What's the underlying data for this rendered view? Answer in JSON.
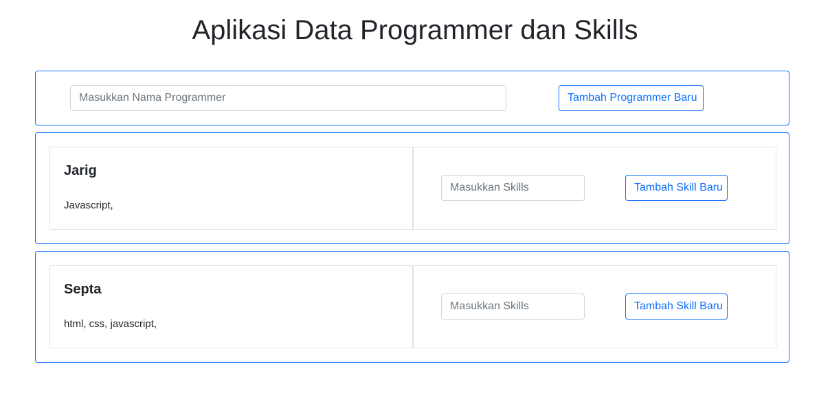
{
  "page": {
    "title": "Aplikasi Data Programmer dan Skills"
  },
  "add_programmer": {
    "name_placeholder": "Masukkan Nama Programmer",
    "name_value": "",
    "button_label": "Tambah Programmer Baru"
  },
  "programmers": [
    {
      "name": "Jarig",
      "skills": "Javascript,",
      "skill_placeholder": "Masukkan Skills",
      "skill_value": "",
      "button_label": "Tambah Skill Baru"
    },
    {
      "name": "Septa",
      "skills": "html, css, javascript,",
      "skill_placeholder": "Masukkan Skills",
      "skill_value": "",
      "button_label": "Tambah Skill Baru"
    }
  ],
  "colors": {
    "accent": "#0d6efd",
    "border_light": "#dee2e6",
    "text": "#212529",
    "placeholder": "#6c757d"
  }
}
